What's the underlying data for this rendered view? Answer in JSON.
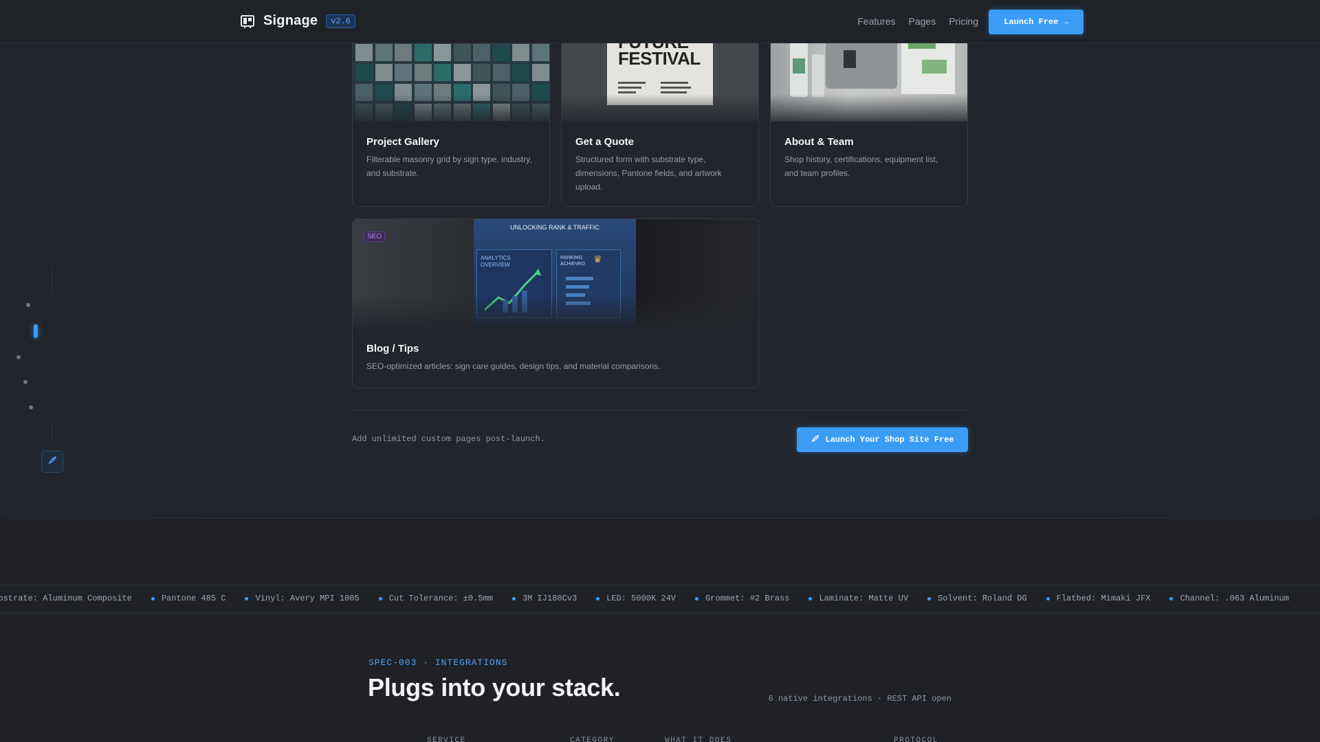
{
  "nav": {
    "brand": "Signage",
    "version": "v2.6",
    "links": [
      "Features",
      "Pages",
      "Pricing"
    ],
    "cta": "Launch Free →"
  },
  "cards": [
    {
      "title": "Project Gallery",
      "desc": "Filterable masonry grid by sign type, industry, and substrate."
    },
    {
      "title": "Get a Quote",
      "desc": "Structured form with substrate type, dimensions, Pantone fields, and artwork upload."
    },
    {
      "title": "About & Team",
      "desc": "Shop history, certifications, equipment list, and team profiles."
    },
    {
      "title": "Blog / Tips",
      "desc": "SEO-optimized articles: sign care guides, design tips, and material comparisons."
    }
  ],
  "images": {
    "festival_title": "FUTURE FESTIVAL",
    "seo_badge": "SEO",
    "seo_subtitle": "UNLOCKING RANK & TRAFFIC",
    "seo_panel_left": "ANALYTICS OVERVIEW",
    "seo_panel_right": "RANKING ACHIEVED"
  },
  "footer_row": {
    "note": "Add unlimited custom pages post-launch.",
    "cta": "Launch Your Shop Site Free"
  },
  "ticker": [
    "Substrate: Aluminum Composite",
    "Pantone 485 C",
    "Vinyl: Avery MPI 1005",
    "Cut Tolerance: ±0.5mm",
    "3M IJ180Cv3",
    "LED: 5000K 24V",
    "Grommet: #2 Brass",
    "Laminate: Matte UV",
    "Solvent: Roland DG",
    "Flatbed: Mimaki JFX",
    "Channel: .063 Aluminum"
  ],
  "integrations": {
    "eyebrow": "SPEC-003 · INTEGRATIONS",
    "headline": "Plugs into your stack.",
    "meta": "6 native integrations · REST API open",
    "columns": [
      "SERVICE",
      "CATEGORY",
      "WHAT IT DOES",
      "PROTOCOL"
    ]
  },
  "colors": {
    "accent": "#3b9cf6",
    "background": "#22252b",
    "card_border": "#363a42"
  }
}
